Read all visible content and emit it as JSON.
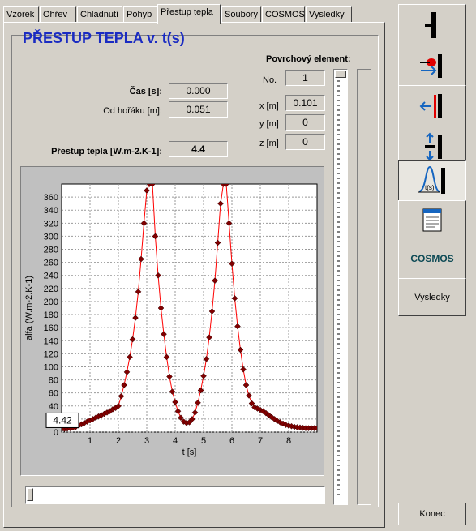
{
  "tabs": [
    "Vzorek",
    "Ohřev",
    "Chladnutí",
    "Pohyb",
    "Přestup tepla",
    "Soubory",
    "COSMOS",
    "Vysledky"
  ],
  "active_tab": "Přestup tepla",
  "panel_title": "PŘESTUP TEPLA v. t(s)",
  "time_label": "Čas [s]:",
  "time_value": "0.000",
  "distance_label": "Od hořáku [m]:",
  "distance_value": "0.051",
  "htc_label": "Přestup tepla [W.m-2.K-1]:",
  "htc_value": "4.4",
  "surface_element": {
    "title": "Povrchový element:",
    "no_label": "No.",
    "no_value": "1",
    "x_label": "x [m]",
    "x_value": "0.101",
    "y_label": "y [m]",
    "y_value": "0",
    "z_label": "z [m]",
    "z_value": "0"
  },
  "cursor_readout": "4.42",
  "sidebar": {
    "buttons": [
      {
        "name": "specimen",
        "icon": "specimen-bar-icon"
      },
      {
        "name": "heating",
        "icon": "burner-heating-icon"
      },
      {
        "name": "cooling",
        "icon": "cooling-arrow-icon"
      },
      {
        "name": "movement",
        "icon": "move-vertical-icon"
      },
      {
        "name": "heat-transfer",
        "icon": "heat-transfer-curve-icon",
        "pressed": true
      },
      {
        "name": "files",
        "icon": "notepad-icon"
      },
      {
        "name": "cosmos",
        "label": "COSMOS"
      },
      {
        "name": "results",
        "label": "Vysledky"
      }
    ],
    "exit_label": "Konec"
  },
  "chart_data": {
    "type": "line",
    "xlabel": "t [s]",
    "ylabel": "alfa (W.m-2.K-1)",
    "xlim": [
      0,
      9
    ],
    "ylim": [
      0,
      380
    ],
    "xticks": [
      1,
      2,
      3,
      4,
      5,
      6,
      7,
      8
    ],
    "yticks": [
      0,
      20,
      40,
      60,
      80,
      100,
      120,
      140,
      160,
      180,
      200,
      220,
      240,
      260,
      280,
      300,
      320,
      340,
      360
    ],
    "grid": true,
    "line_color": "#ff0000",
    "marker_color": "#800000",
    "x": [
      0.0,
      0.1,
      0.2,
      0.3,
      0.4,
      0.5,
      0.6,
      0.7,
      0.8,
      0.9,
      1.0,
      1.1,
      1.2,
      1.3,
      1.4,
      1.5,
      1.6,
      1.7,
      1.8,
      1.9,
      2.0,
      2.1,
      2.2,
      2.3,
      2.4,
      2.5,
      2.6,
      2.7,
      2.8,
      2.9,
      3.0,
      3.1,
      3.2,
      3.3,
      3.4,
      3.5,
      3.6,
      3.7,
      3.8,
      3.9,
      4.0,
      4.1,
      4.2,
      4.3,
      4.4,
      4.5,
      4.6,
      4.7,
      4.8,
      4.9,
      5.0,
      5.1,
      5.2,
      5.3,
      5.4,
      5.5,
      5.6,
      5.7,
      5.8,
      5.9,
      6.0,
      6.1,
      6.2,
      6.3,
      6.4,
      6.5,
      6.6,
      6.7,
      6.8,
      6.9,
      7.0,
      7.1,
      7.2,
      7.3,
      7.4,
      7.5,
      7.6,
      7.7,
      7.8,
      7.9,
      8.0,
      8.1,
      8.2,
      8.3,
      8.4,
      8.5,
      8.6,
      8.7,
      8.8,
      8.9,
      9.0
    ],
    "y": [
      4.4,
      5,
      5.5,
      6,
      7,
      8,
      10,
      12,
      14,
      16,
      18,
      20,
      22,
      24,
      26,
      28,
      30,
      32,
      35,
      37,
      40,
      55,
      72,
      92,
      115,
      142,
      175,
      215,
      265,
      320,
      370,
      380,
      380,
      300,
      240,
      190,
      150,
      115,
      85,
      62,
      46,
      32,
      22,
      16,
      14,
      15,
      20,
      30,
      45,
      64,
      86,
      112,
      145,
      185,
      232,
      290,
      350,
      380,
      380,
      320,
      258,
      205,
      162,
      126,
      96,
      72,
      56,
      44,
      38,
      36,
      34,
      32,
      29,
      26,
      23,
      20,
      17,
      15,
      13,
      11,
      10,
      9,
      8,
      7.5,
      7,
      6.5,
      6,
      6,
      6,
      6,
      6
    ]
  }
}
